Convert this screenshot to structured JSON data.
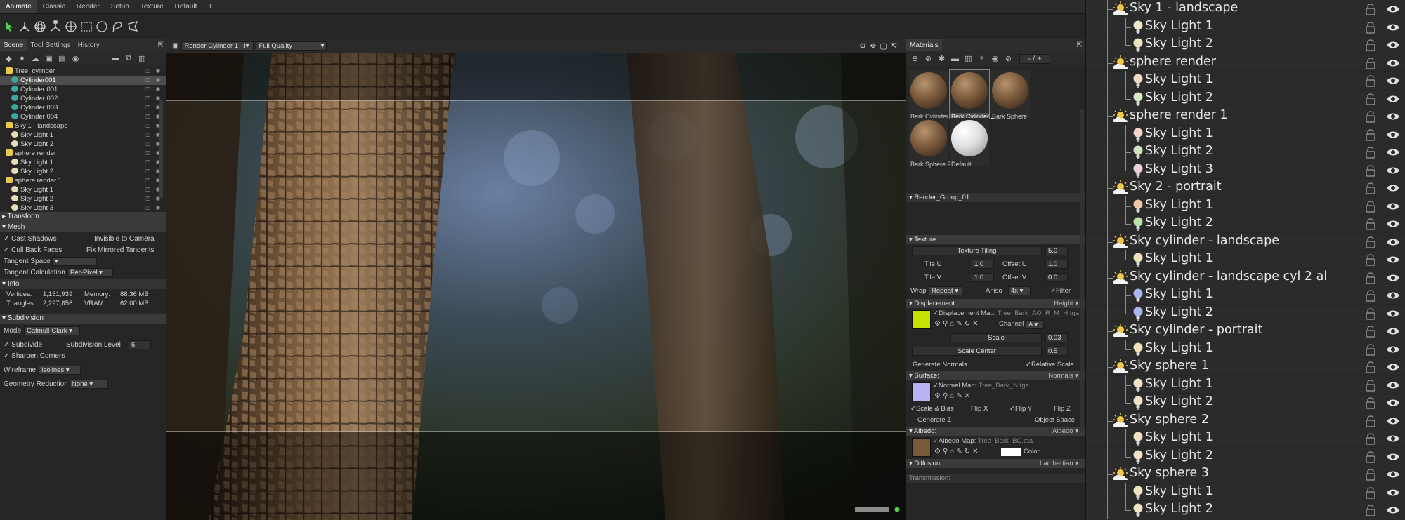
{
  "top_tabs": [
    "Animate",
    "Classic",
    "Render",
    "Setup",
    "Texture",
    "Default",
    "+"
  ],
  "scene_panel": {
    "tabs": [
      "Scene",
      "Tool Settings",
      "History"
    ],
    "tree": [
      {
        "label": "Tree_cylinder",
        "level": 0,
        "sel": false
      },
      {
        "label": "Cylinder001",
        "level": 1,
        "sel": true
      },
      {
        "label": "Cylinder 001",
        "level": 1,
        "sel": false
      },
      {
        "label": "Cylinder 002",
        "level": 1,
        "sel": false
      },
      {
        "label": "Cylinder 003",
        "level": 1,
        "sel": false
      },
      {
        "label": "Cylinder 004",
        "level": 1,
        "sel": false
      },
      {
        "label": "Sky 1 - landscape",
        "level": 0,
        "sel": false
      },
      {
        "label": "Sky Light 1",
        "level": 1,
        "sel": false
      },
      {
        "label": "Sky Light 2",
        "level": 1,
        "sel": false
      },
      {
        "label": "sphere render",
        "level": 0,
        "sel": false
      },
      {
        "label": "Sky Light 1",
        "level": 1,
        "sel": false
      },
      {
        "label": "Sky Light 2",
        "level": 1,
        "sel": false
      },
      {
        "label": "sphere render 1",
        "level": 0,
        "sel": false
      },
      {
        "label": "Sky Light 1",
        "level": 1,
        "sel": false
      },
      {
        "label": "Sky Light 2",
        "level": 1,
        "sel": false
      },
      {
        "label": "Sky Light 3",
        "level": 1,
        "sel": false
      }
    ],
    "transform": "Transform",
    "mesh": "Mesh",
    "cast_shadows": "Cast Shadows",
    "invisible_to_camera": "Invisible to Camera",
    "cull_back_faces": "Cull Back Faces",
    "fix_mirrored_tangents": "Fix Mirrored Tangents",
    "tangent_space_label": "Tangent Space",
    "tangent_calc_label": "Tangent Calculation",
    "tangent_calc_value": "Per-Pixel",
    "info": "Info",
    "vertices_label": "Vertices:",
    "vertices_value": "1,151,939",
    "memory_label": "Memory:",
    "memory_value": "88.36 MB",
    "triangles_label": "Triangles:",
    "triangles_value": "2,297,856",
    "vram_label": "VRAM:",
    "vram_value": "62.00 MB",
    "subdivision": "Subdivision",
    "mode_label": "Mode",
    "mode_value": "Catmull-Clark",
    "subdivide_label": "Subdivide",
    "subdiv_level_label": "Subdivision Level",
    "subdiv_level_value": "6",
    "sharpen_corners": "Sharpen Corners",
    "wireframe_label": "Wireframe",
    "wireframe_value": "Isolines",
    "geo_reduction_label": "Geometry Reduction",
    "geo_reduction_value": "None"
  },
  "viewport": {
    "camera": "Render Cylinder 1 - l",
    "quality": "Full Quality"
  },
  "materials": {
    "tab": "Materials",
    "search": "- / +",
    "items": [
      {
        "label": "Bark Cylinder",
        "kind": "bark",
        "sel": false
      },
      {
        "label": "Bark Cylinder 2",
        "kind": "bark",
        "sel": true
      },
      {
        "label": "Bark Sphere",
        "kind": "bark",
        "sel": false
      },
      {
        "label": "Bark Sphere 2",
        "kind": "bark",
        "sel": false
      },
      {
        "label": "Default",
        "kind": "white",
        "sel": false
      }
    ],
    "group": "Render_Group_01",
    "texture": "Texture",
    "texture_tiling_label": "Texture Tiling",
    "texture_tiling_value": "5.0",
    "tile_u_label": "Tile U",
    "tile_u_value": "1.0",
    "offset_u_label": "Offset U",
    "offset_u_value": "1.0",
    "tile_v_label": "Tile V",
    "tile_v_value": "1.0",
    "offset_v_label": "Offset V",
    "offset_v_value": "0.0",
    "wrap_label": "Wrap",
    "wrap_value": "Repeat",
    "aniso_label": "Aniso",
    "aniso_value": "4x",
    "filter_label": "Filter",
    "displacement": "Displacement:",
    "displacement_mode": "Height",
    "disp_map_label": "Displacement Map:",
    "disp_map_file": "Tree_Bark_AO_R_M_H.tga",
    "channel_label": "Channel",
    "channel_value": "A",
    "scale_label": "Scale",
    "scale_value": "0.03",
    "scale_center_label": "Scale Center",
    "scale_center_value": "0.5",
    "generate_normals": "Generate Normals",
    "relative_scale": "Relative Scale",
    "surface": "Surface:",
    "surface_mode": "Normals",
    "normal_map_label": "Normal Map:",
    "normal_map_file": "Tree_Bark_N.tga",
    "scale_bias": "Scale & Bias",
    "flip_x": "Flip X",
    "flip_y": "Flip Y",
    "flip_z": "Flip Z",
    "generate_z": "Generate Z",
    "object_space": "Object Space",
    "albedo": "Albedo:",
    "albedo_mode": "Albedo",
    "albedo_map_label": "Albedo Map:",
    "albedo_map_file": "Tree_Bark_BC.tga",
    "color_label": "Color",
    "diffusion": "Diffusion:",
    "diffusion_mode": "Lambertian",
    "transmission": "Transmission:"
  },
  "outliner": {
    "rows": [
      {
        "label": "Sky 1 - landscape",
        "type": "sky",
        "bulb": "#e8dcbc"
      },
      {
        "label": "Sky Light 1",
        "type": "light",
        "bulb": "#f0e6c8"
      },
      {
        "label": "Sky Light 2",
        "type": "light",
        "bulb": "#efe3c2"
      },
      {
        "label": "sphere render",
        "type": "sky",
        "bulb": "#e8dcbc"
      },
      {
        "label": "Sky Light 1",
        "type": "light",
        "bulb": "#f3d9c2"
      },
      {
        "label": "Sky Light 2",
        "type": "light",
        "bulb": "#d5e8c4"
      },
      {
        "label": "sphere render 1",
        "type": "sky",
        "bulb": "#e8dcbc"
      },
      {
        "label": "Sky Light 1",
        "type": "light",
        "bulb": "#f2d4c8"
      },
      {
        "label": "Sky Light 2",
        "type": "light",
        "bulb": "#cfe6c6"
      },
      {
        "label": "Sky Light 3",
        "type": "light",
        "bulb": "#f0d0d2"
      },
      {
        "label": "Sky 2 - portrait",
        "type": "sky",
        "bulb": "#e8dcbc"
      },
      {
        "label": "Sky Light 1",
        "type": "light",
        "bulb": "#f3c7a6"
      },
      {
        "label": "Sky Light 2",
        "type": "light",
        "bulb": "#b9e3a8"
      },
      {
        "label": "Sky cylinder - landscape",
        "type": "sky",
        "bulb": "#e8dcbc"
      },
      {
        "label": "Sky Light 1",
        "type": "light",
        "bulb": "#f0e0bc"
      },
      {
        "label": "Sky cylinder - landscape cyl 2 al",
        "type": "sky",
        "bulb": "#e8dcbc"
      },
      {
        "label": "Sky Light 1",
        "type": "light",
        "bulb": "#a9b6ef"
      },
      {
        "label": "Sky Light 2",
        "type": "light",
        "bulb": "#a9b6ef"
      },
      {
        "label": "Sky cylinder - portrait",
        "type": "sky",
        "bulb": "#e8dcbc"
      },
      {
        "label": "Sky Light 1",
        "type": "light",
        "bulb": "#f0e0bc"
      },
      {
        "label": "Sky sphere 1",
        "type": "sky",
        "bulb": "#e8dcbc"
      },
      {
        "label": "Sky Light 1",
        "type": "light",
        "bulb": "#f0e2c2"
      },
      {
        "label": "Sky Light 2",
        "type": "light",
        "bulb": "#f0e2c2"
      },
      {
        "label": "Sky sphere 2",
        "type": "sky",
        "bulb": "#e8dcbc"
      },
      {
        "label": "Sky Light 1",
        "type": "light",
        "bulb": "#f0e2c2"
      },
      {
        "label": "Sky Light 2",
        "type": "light",
        "bulb": "#f0e2c2"
      },
      {
        "label": "Sky sphere 3",
        "type": "sky",
        "bulb": "#e8dcbc"
      },
      {
        "label": "Sky Light 1",
        "type": "light",
        "bulb": "#f0e2c2"
      },
      {
        "label": "Sky Light 2",
        "type": "light",
        "bulb": "#f0e2c2"
      }
    ]
  },
  "colors": {
    "accent": "#4a90d9",
    "status_green": "#4fd04f",
    "disp_swatch": "#c8e000",
    "normal_swatch": "#b6b2f4",
    "albedo_swatch": "#7a5a3a"
  }
}
